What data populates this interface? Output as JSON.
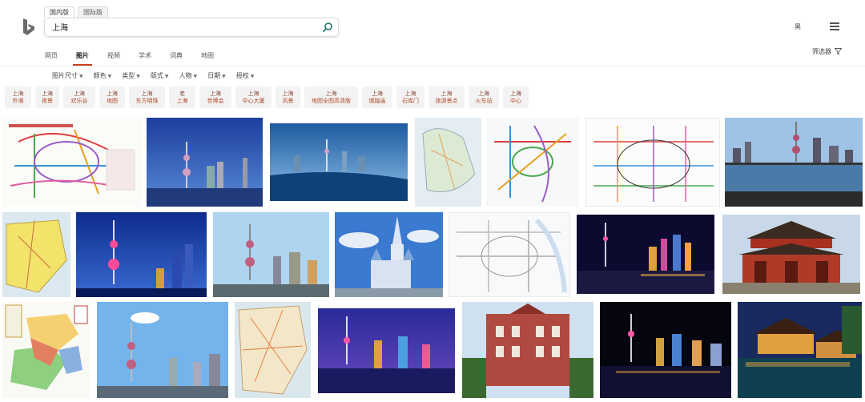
{
  "header": {
    "scope_tabs": [
      "国内版",
      "国际版"
    ],
    "search_value": "上海",
    "signin": "黑"
  },
  "nav": {
    "tabs": [
      "网页",
      "图片",
      "视频",
      "学术",
      "词典",
      "地图"
    ],
    "active": "图片",
    "filter_label": "筛选器"
  },
  "filters": [
    "图片尺寸",
    "颜色",
    "类型",
    "版式",
    "人物",
    "日期",
    "授权"
  ],
  "chips": [
    {
      "l1": "上海",
      "l2": "外滩"
    },
    {
      "l1": "上海",
      "l2": "夜景"
    },
    {
      "l1": "上海",
      "l2": "欢乐谷"
    },
    {
      "l1": "上海",
      "l2": "地图"
    },
    {
      "l1": "上海",
      "l2": "东方明珠"
    },
    {
      "l1": "老",
      "l2": "上海"
    },
    {
      "l1": "上海",
      "l2": "世博会"
    },
    {
      "l1": "上海",
      "l2": "中心大厦"
    },
    {
      "l1": "上海",
      "l2": "风景"
    },
    {
      "l1": "上海",
      "l2": "地图全图高清版"
    },
    {
      "l1": "上海",
      "l2": "城隍庙"
    },
    {
      "l1": "上海",
      "l2": "石库门"
    },
    {
      "l1": "上海",
      "l2": "旅游景点"
    },
    {
      "l1": "上海",
      "l2": "火车站"
    },
    {
      "l1": "上海",
      "l2": "中心"
    }
  ],
  "thumbnails": [
    {
      "kind": "metro-map",
      "desc": "metro"
    },
    {
      "kind": "skyline",
      "desc": "pearl-blue"
    },
    {
      "kind": "skyline",
      "desc": "bund-dusk"
    },
    {
      "kind": "city-map",
      "desc": "map-light"
    },
    {
      "kind": "metro-map",
      "desc": "metro-2"
    },
    {
      "kind": "metro-map",
      "desc": "metro-3"
    },
    {
      "kind": "skyline",
      "desc": "reflection"
    },
    {
      "kind": "city-map",
      "desc": "map-yellow"
    },
    {
      "kind": "skyline",
      "desc": "night-tower"
    },
    {
      "kind": "skyline",
      "desc": "day-tower"
    },
    {
      "kind": "castle",
      "desc": "disney"
    },
    {
      "kind": "metro-map",
      "desc": "metro-4"
    },
    {
      "kind": "skyline",
      "desc": "night-bund"
    },
    {
      "kind": "temple",
      "desc": "temple-gate"
    },
    {
      "kind": "city-map",
      "desc": "district-map"
    },
    {
      "kind": "skyline",
      "desc": "pearl-day"
    },
    {
      "kind": "city-map",
      "desc": "map-2"
    },
    {
      "kind": "skyline",
      "desc": "purple-night"
    },
    {
      "kind": "building",
      "desc": "brick-building"
    },
    {
      "kind": "skyline",
      "desc": "dark-night"
    },
    {
      "kind": "temple",
      "desc": "yuyuan"
    }
  ]
}
